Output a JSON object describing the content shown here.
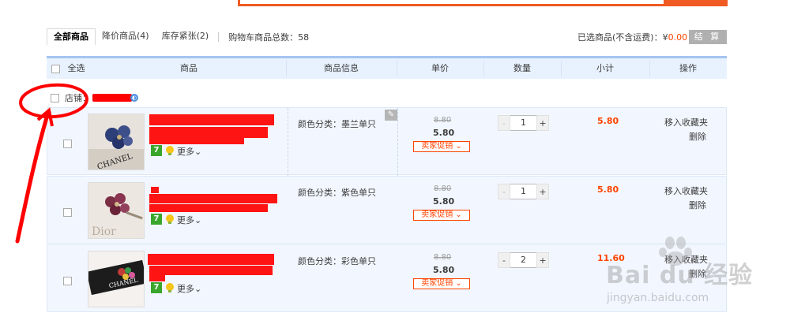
{
  "tabs": [
    {
      "label": "全部商品"
    },
    {
      "label": "降价商品(4)"
    },
    {
      "label": "库存紧张(2)"
    }
  ],
  "cart_total_label": "购物车商品总数：58",
  "selected": {
    "label": "已选商品(不含运费)：",
    "currency": "¥",
    "amount": "0.00"
  },
  "checkout_label": "结 算",
  "table_header": {
    "select_all": "全选",
    "product": "商品",
    "info": "商品信息",
    "unit_price": "单价",
    "quantity": "数量",
    "subtotal": "小计",
    "action": "操作"
  },
  "shop_label": "店铺：",
  "items": [
    {
      "spec": "颜色分类：墨兰单只",
      "orig_price": "8.80",
      "price": "5.80",
      "promo": "卖家促销",
      "qty": "1",
      "subtotal": "5.80",
      "more": "更多",
      "badge": "7"
    },
    {
      "spec": "颜色分类：紫色单只",
      "orig_price": "8.80",
      "price": "5.80",
      "promo": "卖家促销",
      "qty": "1",
      "subtotal": "5.80",
      "more": "更多",
      "badge": "7"
    },
    {
      "spec": "颜色分类：彩色单只",
      "orig_price": "8.80",
      "price": "5.80",
      "promo": "卖家促销",
      "qty": "2",
      "subtotal": "11.60",
      "more": "更多",
      "badge": "7"
    }
  ],
  "actions": {
    "favorite": "移入收藏夹",
    "delete": "删除"
  },
  "watermark": {
    "brand": "Bai du 经验",
    "url": "jingyan.baidu.com"
  },
  "colors": {
    "accent": "#ff4400",
    "header_bg": "#e8f2ff",
    "item_bg": "#f2f7ff",
    "annotation": "#ff0000"
  }
}
